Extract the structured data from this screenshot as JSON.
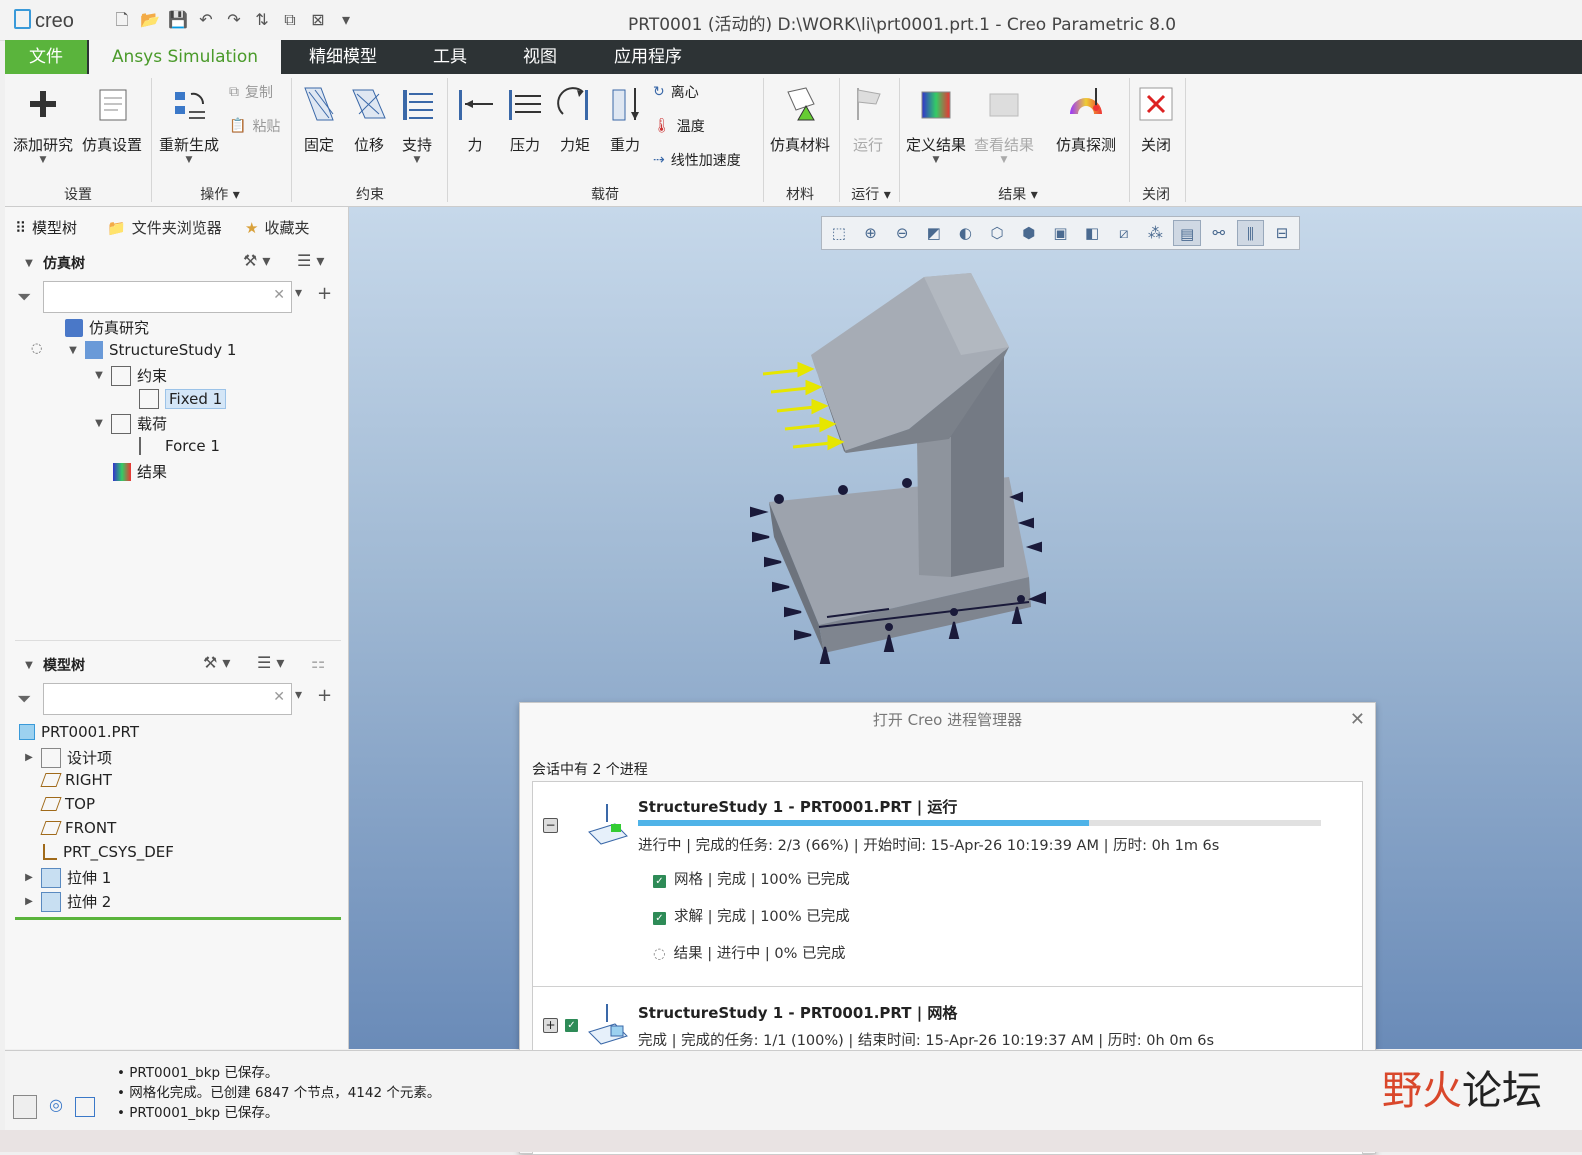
{
  "app": {
    "logo": "creo",
    "window_title": "PRT0001 (活动的) D:\\WORK\\li\\prt0001.prt.1 - Creo Parametric 8.0"
  },
  "tabs": [
    "文件",
    "Ansys Simulation",
    "精细模型",
    "工具",
    "视图",
    "应用程序"
  ],
  "ribbon": {
    "setup": {
      "add_study": "添加研究",
      "sim_setup": "仿真设置",
      "group": "设置"
    },
    "ops": {
      "regenerate": "重新生成",
      "copy": "复制",
      "paste": "粘贴",
      "group": "操作"
    },
    "constraints": {
      "fixed": "固定",
      "displacement": "位移",
      "support": "支持",
      "group": "约束"
    },
    "loads": {
      "force": "力",
      "pressure": "压力",
      "moment": "力矩",
      "gravity": "重力",
      "centrifugal": "离心",
      "temperature": "温度",
      "linear_accel": "线性加速度",
      "group": "载荷"
    },
    "material": {
      "sim_material": "仿真材料",
      "group": "材料"
    },
    "run": {
      "run": "运行",
      "group": "运行"
    },
    "results": {
      "define": "定义结果",
      "view": "查看结果",
      "probe": "仿真探测",
      "group": "结果"
    },
    "close": {
      "close": "关闭",
      "group": "关闭"
    }
  },
  "panel_tabs": {
    "model_tree": "模型树",
    "folder_browser": "文件夹浏览器",
    "favorites": "收藏夹"
  },
  "sim_tree": {
    "header": "仿真树",
    "items": {
      "sim_study": "仿真研究",
      "structure_study": "StructureStudy 1",
      "constraints": "约束",
      "fixed": "Fixed 1",
      "loads": "载荷",
      "force": "Force 1",
      "results": "结果"
    }
  },
  "model_tree": {
    "header": "模型树",
    "items": {
      "part": "PRT0001.PRT",
      "design_items": "设计项",
      "right": "RIGHT",
      "top": "TOP",
      "front": "FRONT",
      "csys": "PRT_CSYS_DEF",
      "extrude1": "拉伸 1",
      "extrude2": "拉伸 2"
    }
  },
  "dialog": {
    "title": "打开 Creo 进程管理器",
    "count": "会话中有 2 个进程",
    "proc1": {
      "title": "StructureStudy 1 - PRT0001.PRT | 运行",
      "progress": 0.66,
      "status": "进行中 | 完成的任务: 2/3 (66%) | 开始时间: 15-Apr-26 10:19:39 AM | 历时: 0h 1m 6s",
      "tasks": {
        "mesh": "网格 | 完成 | 100% 已完成",
        "solve": "求解 | 完成 | 100% 已完成",
        "results": "结果 | 进行中 | 0% 已完成"
      }
    },
    "proc2": {
      "title": "StructureStudy 1 - PRT0001.PRT | 网格",
      "status": "完成 | 完成的任务: 1/1 (100%) | 结束时间: 15-Apr-26 10:19:37 AM | 历时: 0h 0m 6s"
    }
  },
  "messages": [
    "PRT0001_bkp 已保存。",
    "网格化完成。已创建 6847 个节点，4142 个元素。",
    "PRT0001_bkp 已保存。"
  ],
  "watermark": {
    "a": "野火",
    "b": "论坛"
  },
  "colors": {
    "accent_green": "#5ab43c",
    "tab_bar": "#2d3335",
    "progress": "#4fb3e8",
    "force_arrow": "#e6e600"
  }
}
